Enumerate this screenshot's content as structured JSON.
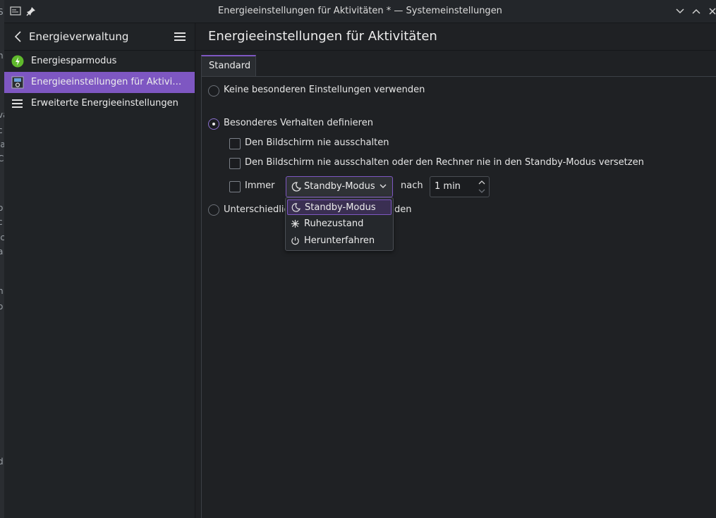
{
  "window": {
    "title": "Energieeinstellungen für Aktivitäten * — Systemeinstellungen"
  },
  "sidebar": {
    "title": "Energieverwaltung",
    "items": [
      {
        "label": "Energiesparmodus",
        "icon": "lightning-icon",
        "selected": false
      },
      {
        "label": "Energieeinstellungen für Aktivi…",
        "icon": "activities-icon",
        "selected": true
      },
      {
        "label": "Erweiterte Energieeinstellungen",
        "icon": "menu-lines-icon",
        "selected": false
      }
    ]
  },
  "main": {
    "page_title": "Energieeinstellungen für Aktivitäten",
    "tabs": [
      {
        "label": "Standard",
        "selected": true
      }
    ],
    "options": {
      "no_special": "Keine besonderen Einstellungen verwenden",
      "define_behavior": "Besonderes Verhalten definieren",
      "never_screen_off": "Den Bildschirm nie ausschalten",
      "never_screen_or_standby": "Den Bildschirm nie ausschalten oder den Rechner nie in den Standby-Modus versetzen",
      "always_label": "Immer",
      "after_label": "nach",
      "different_partial_left": "Unterschiedlic",
      "different_partial_right": "den"
    },
    "combo": {
      "value": "Standby-Modus"
    },
    "spinbox": {
      "value": "1 min"
    },
    "dropdown": [
      {
        "label": "Standby-Modus",
        "icon": "moon-icon",
        "highlighted": true
      },
      {
        "label": "Ruhezustand",
        "icon": "snowflake-icon",
        "highlighted": false
      },
      {
        "label": "Herunterfahren",
        "icon": "power-icon",
        "highlighted": false
      }
    ]
  },
  "accent_color": "#7e57c2"
}
